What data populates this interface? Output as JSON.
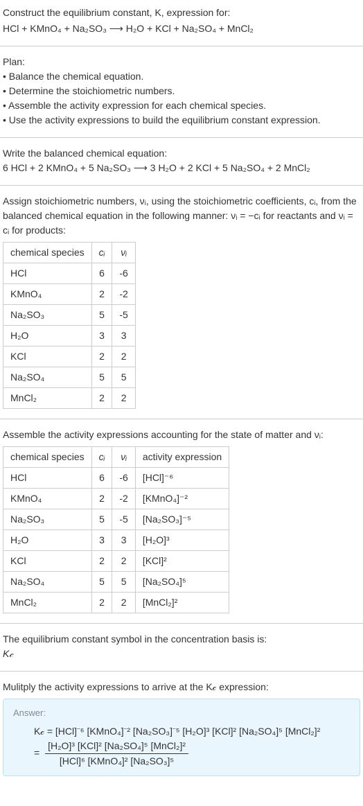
{
  "intro": {
    "line1": "Construct the equilibrium constant, K, expression for:",
    "line2": "HCl + KMnO₄ + Na₂SO₃ ⟶ H₂O + KCl + Na₂SO₄ + MnCl₂"
  },
  "plan": {
    "title": "Plan:",
    "items": [
      "• Balance the chemical equation.",
      "• Determine the stoichiometric numbers.",
      "• Assemble the activity expression for each chemical species.",
      "• Use the activity expressions to build the equilibrium constant expression."
    ]
  },
  "balanced": {
    "title": "Write the balanced chemical equation:",
    "eq": "6 HCl + 2 KMnO₄ + 5 Na₂SO₃ ⟶ 3 H₂O + 2 KCl + 5 Na₂SO₄ + 2 MnCl₂"
  },
  "assign": {
    "text1": "Assign stoichiometric numbers, νᵢ, using the stoichiometric coefficients, cᵢ, from the balanced chemical equation in the following manner: νᵢ = −cᵢ for reactants and νᵢ = cᵢ for products:",
    "headers": [
      "chemical species",
      "cᵢ",
      "νᵢ"
    ],
    "rows": [
      {
        "sp": "HCl",
        "c": "6",
        "v": "-6"
      },
      {
        "sp": "KMnO₄",
        "c": "2",
        "v": "-2"
      },
      {
        "sp": "Na₂SO₃",
        "c": "5",
        "v": "-5"
      },
      {
        "sp": "H₂O",
        "c": "3",
        "v": "3"
      },
      {
        "sp": "KCl",
        "c": "2",
        "v": "2"
      },
      {
        "sp": "Na₂SO₄",
        "c": "5",
        "v": "5"
      },
      {
        "sp": "MnCl₂",
        "c": "2",
        "v": "2"
      }
    ]
  },
  "assemble": {
    "title": "Assemble the activity expressions accounting for the state of matter and νᵢ:",
    "headers": [
      "chemical species",
      "cᵢ",
      "νᵢ",
      "activity expression"
    ],
    "rows": [
      {
        "sp": "HCl",
        "c": "6",
        "v": "-6",
        "a": "[HCl]⁻⁶"
      },
      {
        "sp": "KMnO₄",
        "c": "2",
        "v": "-2",
        "a": "[KMnO₄]⁻²"
      },
      {
        "sp": "Na₂SO₃",
        "c": "5",
        "v": "-5",
        "a": "[Na₂SO₃]⁻⁵"
      },
      {
        "sp": "H₂O",
        "c": "3",
        "v": "3",
        "a": "[H₂O]³"
      },
      {
        "sp": "KCl",
        "c": "2",
        "v": "2",
        "a": "[KCl]²"
      },
      {
        "sp": "Na₂SO₄",
        "c": "5",
        "v": "5",
        "a": "[Na₂SO₄]⁵"
      },
      {
        "sp": "MnCl₂",
        "c": "2",
        "v": "2",
        "a": "[MnCl₂]²"
      }
    ]
  },
  "symbol": {
    "text": "The equilibrium constant symbol in the concentration basis is:",
    "val": "K𝒸"
  },
  "final": {
    "title": "Mulitply the activity expressions to arrive at the K𝒸 expression:",
    "answer_label": "Answer:",
    "line1": "K𝒸 = [HCl]⁻⁶ [KMnO₄]⁻² [Na₂SO₃]⁻⁵ [H₂O]³ [KCl]² [Na₂SO₄]⁵ [MnCl₂]²",
    "eq_prefix": "= ",
    "numerator": "[H₂O]³ [KCl]² [Na₂SO₄]⁵ [MnCl₂]²",
    "denominator": "[HCl]⁶ [KMnO₄]² [Na₂SO₃]⁵"
  },
  "chart_data": {
    "type": "table",
    "title": "Stoichiometric numbers",
    "columns": [
      "chemical species",
      "cᵢ",
      "νᵢ"
    ],
    "rows": [
      [
        "HCl",
        6,
        -6
      ],
      [
        "KMnO₄",
        2,
        -2
      ],
      [
        "Na₂SO₃",
        5,
        -5
      ],
      [
        "H₂O",
        3,
        3
      ],
      [
        "KCl",
        2,
        2
      ],
      [
        "Na₂SO₄",
        5,
        5
      ],
      [
        "MnCl₂",
        2,
        2
      ]
    ]
  }
}
